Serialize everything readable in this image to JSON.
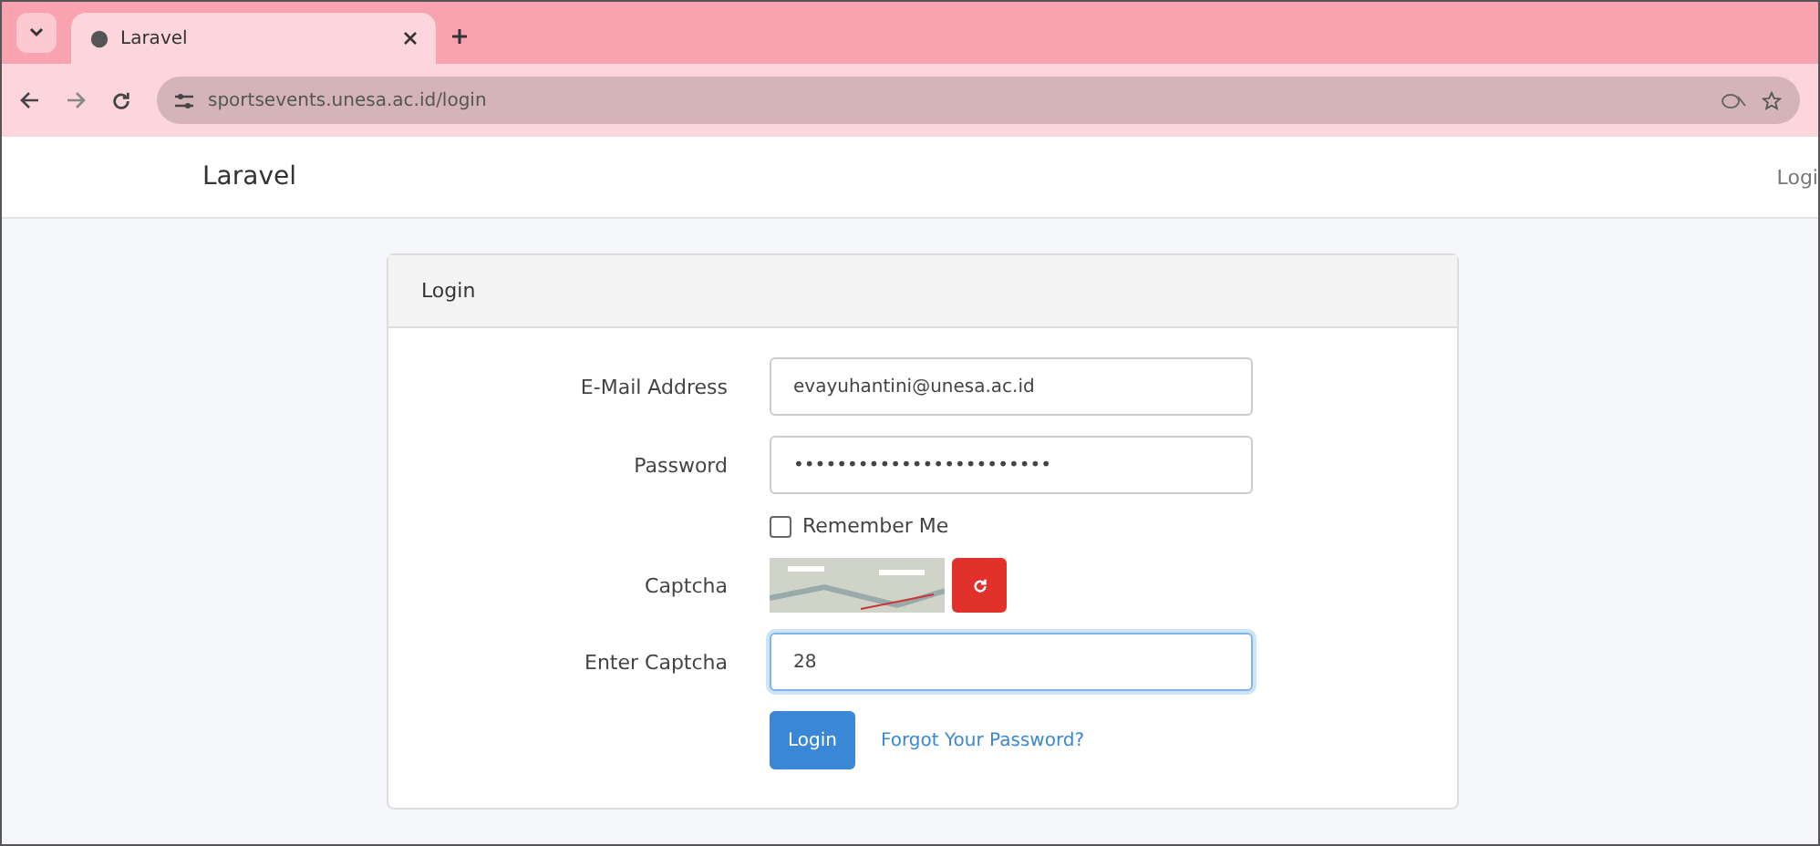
{
  "browser": {
    "tab": {
      "title": "Laravel",
      "selected": true
    },
    "address": "sportsevents.unesa.ac.id/login"
  },
  "navbar": {
    "brand": "Laravel",
    "link": "Logi"
  },
  "card": {
    "title": "Login",
    "fields": [
      {
        "kind": "text",
        "label": "E-Mail Address",
        "value": "evayuhantini@unesa.ac.id",
        "focused": false
      },
      {
        "kind": "text",
        "label": "Password",
        "value": "••••••••••••••••••••••••",
        "focused": false
      },
      {
        "kind": "checkbox",
        "label": "Remember Me",
        "checked": false
      },
      {
        "kind": "captcha",
        "label": "Captcha"
      },
      {
        "kind": "text",
        "label": "Enter Captcha",
        "value": "28",
        "focused": true
      }
    ],
    "submit": "Login",
    "forgot": "Forgot Your Password?"
  }
}
